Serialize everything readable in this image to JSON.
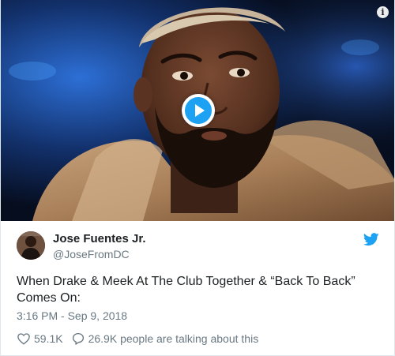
{
  "media": {
    "play_icon": "play-icon",
    "info_icon": "info-icon",
    "info_glyph": "i"
  },
  "author": {
    "name": "Jose Fuentes Jr.",
    "handle": "@JoseFromDC",
    "platform_icon": "twitter-bird-icon"
  },
  "tweet": {
    "text": "When Drake & Meek At The Club Together & “Back To Back” Comes On:",
    "timestamp": "3:16 PM - Sep 9, 2018"
  },
  "actions": {
    "likes": "59.1K",
    "talking": "26.9K people are talking about this"
  },
  "colors": {
    "twitter_blue": "#1da1f2",
    "text": "#1c2022",
    "muted": "#697882"
  }
}
